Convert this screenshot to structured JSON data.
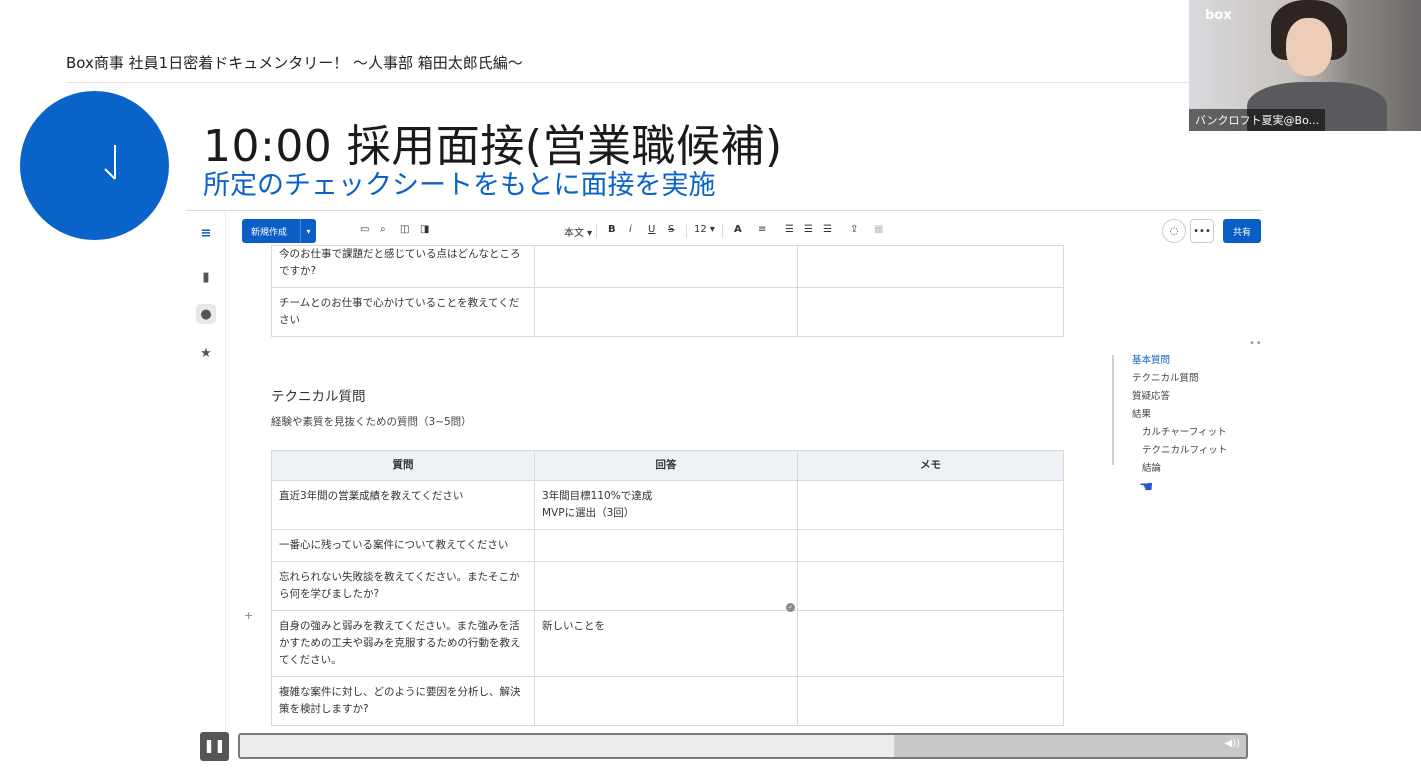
{
  "slide": {
    "caption": "Box商事 社員1日密着ドキュメンタリー！ ～人事部 箱田太郎氏編～",
    "title": "10:00 採用面接(営業職候補)",
    "subtitle": "所定のチェックシートをもとに面接を実施",
    "clock_color": "#0a63c9"
  },
  "webcam": {
    "brand": "box",
    "participant_name": "バンクロフト夏実@Bo..."
  },
  "toolbar": {
    "new_button": "新規作成",
    "text_style": "本文",
    "bold": "B",
    "italic": "i",
    "underline": "U",
    "strike": "S",
    "font_size": "12",
    "font_color": "A",
    "share_button": "共有",
    "more": "•••",
    "accent": "#0a5fc6"
  },
  "doc": {
    "top_rows": [
      {
        "question": "今のお仕事で課題だと感じている点はどんなところですか?",
        "answer": "",
        "memo": ""
      },
      {
        "question": "チームとのお仕事で心かけていることを教えてください",
        "answer": "",
        "memo": ""
      }
    ],
    "section_heading": "テクニカル質問",
    "section_desc": "経験や素質を見抜くための質問（3~5問）",
    "headers": {
      "question": "質問",
      "answer": "回答",
      "memo": "メモ"
    },
    "rows": [
      {
        "question": "直近3年間の営業成績を教えてください",
        "answer_line1": "3年間目標110%で達成",
        "answer_line2": "MVPに選出（3回）",
        "memo": ""
      },
      {
        "question": "一番心に残っている案件について教えてください",
        "answer_line1": "",
        "answer_line2": "",
        "memo": ""
      },
      {
        "question": "忘れられない失敗談を教えてください。またそこから何を学びましたか?",
        "answer_line1": "",
        "answer_line2": "",
        "memo": ""
      },
      {
        "question": "自身の強みと弱みを教えてください。また強みを活かすための工夫や弱みを克服するための行動を教えてください。",
        "answer_line1": "新しいことを",
        "answer_line2": "",
        "memo": ""
      },
      {
        "question": "複雑な案件に対し、どのように要因を分析し、解決策を検討しますか?",
        "answer_line1": "",
        "answer_line2": "",
        "memo": ""
      }
    ]
  },
  "outline": {
    "items": [
      "基本質問",
      "テクニカル質問",
      "質疑応答",
      "結果",
      "カルチャーフィット",
      "テクニカルフィット",
      "結論"
    ]
  },
  "player": {
    "progress_fraction": 0.65
  }
}
